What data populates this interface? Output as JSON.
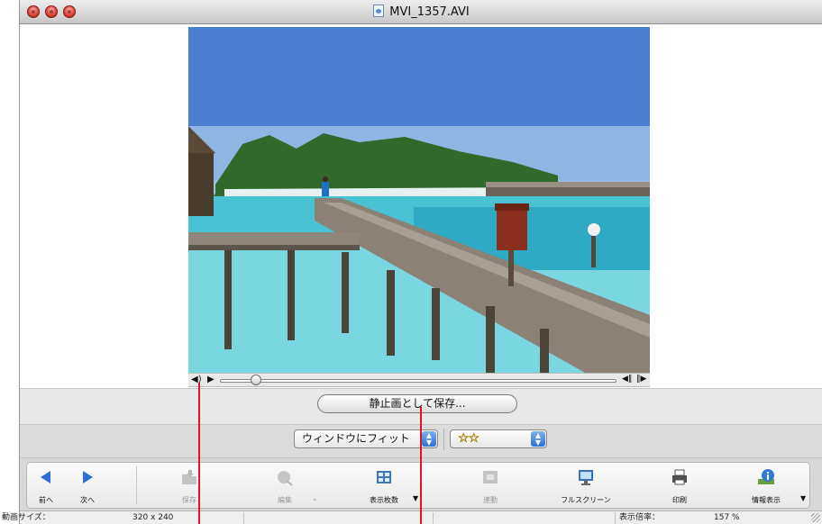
{
  "window": {
    "title": "MVI_1357.AVI"
  },
  "playback": {
    "volume_icon": "speaker-icon",
    "position": 0.09
  },
  "buttons": {
    "save_still": "静止画として保存..."
  },
  "fit_popup": {
    "value": "ウィンドウにフィット"
  },
  "rating_popup": {
    "value": "☆☆"
  },
  "toolbar": {
    "prev": "前へ",
    "next": "次へ",
    "save": "保存",
    "edit": "編集",
    "view_count": "表示枚数",
    "link": "連動",
    "fullscreen": "フルスクリーン",
    "print": "印刷",
    "info": "情報表示"
  },
  "status": {
    "size_label": "動画サイズ：",
    "size_value": "320 x 240",
    "zoom_label": "表示倍率：",
    "zoom_value": "157 %"
  },
  "colors": {
    "accent": "#2d6fd6",
    "annotation": "#e01428"
  }
}
